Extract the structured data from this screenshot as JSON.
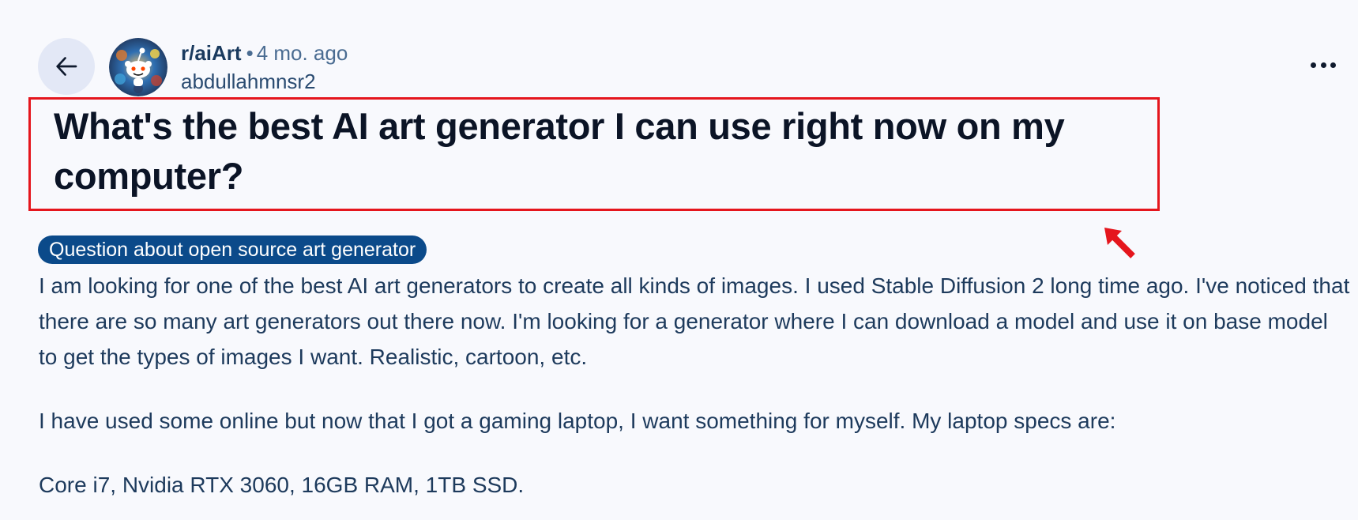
{
  "header": {
    "subreddit": "r/aiArt",
    "separator": "•",
    "post_age": "4 mo. ago",
    "author": "abdullahmnsr2"
  },
  "post": {
    "title": "What's the best AI art generator I can use right now on my computer?",
    "flair": "Question about open source art generator",
    "paragraphs": [
      "I am looking for one of the best AI art generators to create all kinds of images. I used Stable Diffusion 2 long time ago. I've noticed that there are so many art generators out there now. I'm looking for a generator where I can download a model and use it on base model to get the types of images I want. Realistic, cartoon, etc.",
      "I have used some online but now that I got a gaming laptop, I want something for myself. My laptop specs are:",
      "Core i7, Nvidia RTX 3060, 16GB RAM, 1TB SSD."
    ]
  },
  "icons": {
    "back": "arrow-left-icon",
    "overflow": "more-horizontal-icon",
    "annotation": "red-arrow-pointer-icon"
  },
  "colors": {
    "background": "#f8f9fd",
    "flair_bg": "#0b4a8a",
    "highlight_border": "#e5161d",
    "body_text": "#1d3a5c"
  }
}
